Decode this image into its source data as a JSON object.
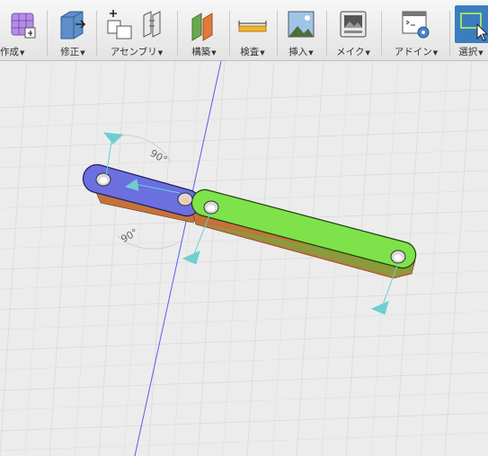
{
  "toolbar": {
    "groups": [
      {
        "id": "create",
        "label": "作成",
        "icon": "grid-cube-icon"
      },
      {
        "id": "modify",
        "label": "修正",
        "icon": "push-pull-icon"
      },
      {
        "id": "assemble",
        "label": "アセンブリ",
        "icon": "joint-icons"
      },
      {
        "id": "construct",
        "label": "構築",
        "icon": "plane-icon"
      },
      {
        "id": "inspect",
        "label": "検査",
        "icon": "ruler-icon"
      },
      {
        "id": "insert",
        "label": "挿入",
        "icon": "image-icon"
      },
      {
        "id": "make",
        "label": "メイク",
        "icon": "printer-icon"
      },
      {
        "id": "addins",
        "label": "アドイン",
        "icon": "script-gear-icon"
      },
      {
        "id": "select",
        "label": "選択",
        "icon": "select-window-icon"
      }
    ],
    "dropdown_glyph": "▼"
  },
  "viewport": {
    "angle_label_top": "90°",
    "angle_label_bottom": "90°",
    "colors": {
      "link_blue": "#6b6fe0",
      "link_green": "#7ee24a",
      "link_orange": "#d8833e",
      "manipulator": "#6ccfd0",
      "axis_blue": "#5b5bf0"
    }
  }
}
